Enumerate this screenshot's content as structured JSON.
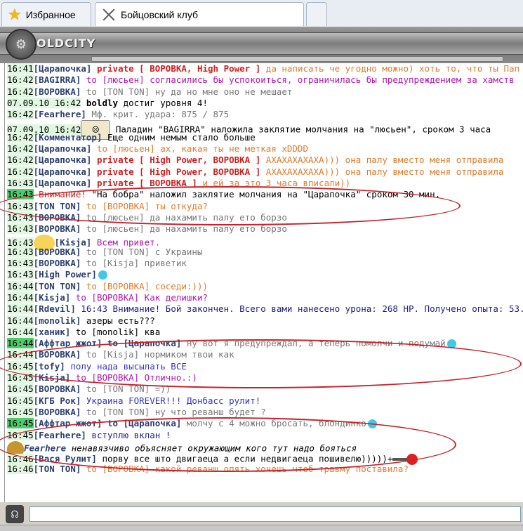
{
  "tabs": [
    {
      "label": "Избранное",
      "icon": "star-icon"
    },
    {
      "label": "Бойцовский клуб",
      "icon": "crossed-swords-icon"
    }
  ],
  "header": {
    "logo_text": "OLDCITY",
    "emblem": "⚙"
  },
  "chat": [
    {
      "ts": "16:41",
      "parts": [
        [
          "nick",
          "[Царапочка]"
        ],
        [
          "private",
          " private [ ВОРОВКА, High Power ]"
        ],
        [
          "m-orange",
          " да написать че угодно можно) хоть то, что ты Пап"
        ]
      ]
    },
    {
      "ts": "16:42",
      "parts": [
        [
          "nick",
          "[BAGIRRA]"
        ],
        [
          "m-magenta",
          " to [люсьен] согласились бы успокоиться, ограничилась бы предупреждением за хамств"
        ]
      ]
    },
    {
      "ts": "16:42",
      "parts": [
        [
          "nick",
          "[ВОРОВКА]"
        ],
        [
          "m-gray",
          " to [TON TON] ну да но мне оно не мешает"
        ]
      ]
    },
    {
      "ts": "07.09.10 16:42",
      "parts": [
        [
          "boldly",
          " boldly"
        ],
        [
          "m-black",
          " достиг уровня 4!"
        ]
      ]
    },
    {
      "ts": "16:42",
      "parts": [
        [
          "nick",
          "[Fearhere]"
        ],
        [
          "m-gray",
          " Мф. крит. удара: 875 / 875"
        ]
      ]
    },
    {
      "ts": "07.09.10 16:42",
      "emote": "scroll",
      "parts": [
        [
          "m-black",
          " Паладин \"BAGIRRA\" наложила заклятие молчания на \"люсьен\", сроком 3 часа"
        ]
      ]
    },
    {
      "ts": "16:42",
      "parts": [
        [
          "nick",
          "[Комментатор]"
        ],
        [
          "m-black",
          " Еще одним немым стало больше"
        ]
      ]
    },
    {
      "ts": "16:42",
      "parts": [
        [
          "nick",
          "[Царапочка]"
        ],
        [
          "m-orange",
          " to [люсьен] ах, какая ты не меткая xDDDD"
        ]
      ]
    },
    {
      "ts": "16:42",
      "parts": [
        [
          "nick",
          "[Царапочка]"
        ],
        [
          "private",
          " private [ High Power, ВОРОВКА ]"
        ],
        [
          "m-orange",
          " АХАХАХАХАХА))) она палу вместо меня отправила"
        ]
      ]
    },
    {
      "ts": "16:42",
      "parts": [
        [
          "nick",
          "[Царапочка]"
        ],
        [
          "private",
          " private [ High Power, ВОРОВКА ]"
        ],
        [
          "m-orange",
          " АХАХАХАХАХА))) она палу вместо меня отправила"
        ]
      ]
    },
    {
      "ts": "16:43",
      "parts": [
        [
          "nick",
          "[Царапочка]"
        ],
        [
          "private",
          " private [ ВОРОВКА ]"
        ],
        [
          "m-orange",
          " и ей за это 3 часа вписали))"
        ]
      ]
    },
    {
      "ts": "16:43",
      "hl": true,
      "parts": [
        [
          "att",
          " Внимание!"
        ],
        [
          "m-black",
          " \"На бобра\" наложил заклятие молчания на \"Царапочка\" сроком 30 мин."
        ]
      ]
    },
    {
      "ts": "16:43",
      "parts": [
        [
          "nick",
          "[TON TON]"
        ],
        [
          "m-orange",
          " to [ВОРОВКА] ты откуда?"
        ]
      ]
    },
    {
      "ts": "16:43",
      "parts": [
        [
          "nick",
          "[ВОРОВКА]"
        ],
        [
          "m-gray",
          " to [люсьен] да нахамить палу ето борзо"
        ]
      ]
    },
    {
      "ts": "16:43",
      "parts": [
        [
          "nick",
          "[ВОРОВКА]"
        ],
        [
          "m-gray",
          " to [люсьен] да нахамить палу ето борзо"
        ]
      ]
    },
    {
      "ts": "16:43",
      "emote": "kisja",
      "parts": [
        [
          "nick",
          "[Kisja]"
        ],
        [
          "m-magenta",
          " Всем привет."
        ]
      ]
    },
    {
      "ts": "16:43",
      "parts": [
        [
          "nick",
          "[ВОРОВКА]"
        ],
        [
          "m-gray",
          " to [TON TON] с Украины"
        ]
      ]
    },
    {
      "ts": "16:43",
      "parts": [
        [
          "nick",
          "[ВОРОВКА]"
        ],
        [
          "m-gray",
          " to [Kisja] приветик"
        ]
      ]
    },
    {
      "ts": "16:43",
      "smile": true,
      "parts": [
        [
          "nick",
          "[High Power]"
        ]
      ]
    },
    {
      "ts": "16:44",
      "parts": [
        [
          "nick",
          "[TON TON]"
        ],
        [
          "m-orange",
          " to [ВОРОВКА] соседи:)))"
        ]
      ]
    },
    {
      "ts": "16:44",
      "parts": [
        [
          "nick",
          "[Kisja]"
        ],
        [
          "m-magenta",
          " to [ВОРОВКА] Как делишки?"
        ]
      ]
    },
    {
      "ts": "16:44",
      "parts": [
        [
          "nick",
          "[Rdevil]"
        ],
        [
          "m-darkblue",
          " 16:43 Внимание! Бой закончен. Всего вами нанесено урона: 268 HP. Получено опыта: 53."
        ]
      ]
    },
    {
      "ts": "16:44",
      "parts": [
        [
          "nick",
          "[monolik]"
        ],
        [
          "m-black",
          " азеры есть???"
        ]
      ]
    },
    {
      "ts": "16:44",
      "parts": [
        [
          "nick",
          "[ханик]"
        ],
        [
          "m-black",
          " to [monolik] ква"
        ]
      ]
    },
    {
      "ts": "16:44",
      "hl": true,
      "smile": true,
      "parts": [
        [
          "nick",
          "[Аффтар жжот]"
        ],
        [
          "nick",
          " to [Царапочка]"
        ],
        [
          "m-gray",
          " ну вот я предупреждал, а теперь помолчи и подумай"
        ]
      ]
    },
    {
      "ts": "16:44",
      "parts": [
        [
          "nick",
          "[ВОРОВКА]"
        ],
        [
          "m-gray",
          " to [Kisja] нормиком твои как"
        ]
      ]
    },
    {
      "ts": "16:45",
      "parts": [
        [
          "nick",
          "[tofy]"
        ],
        [
          "m-blue",
          " полу нада высылать ВСЕ"
        ]
      ]
    },
    {
      "ts": "16:45",
      "parts": [
        [
          "nick",
          "[Kisja]"
        ],
        [
          "m-magenta",
          " to [ВОРОВКА] Отлично.:)"
        ]
      ]
    },
    {
      "ts": "16:45",
      "parts": [
        [
          "nick",
          "[ВОРОВКА]"
        ],
        [
          "m-gray",
          " to [TON TON] =))"
        ]
      ]
    },
    {
      "ts": "16:45",
      "parts": [
        [
          "nick",
          "[КГБ Рок]"
        ],
        [
          "m-blue",
          " Украина FOREVER!!! Донбасс рулит!"
        ]
      ]
    },
    {
      "ts": "16:45",
      "parts": [
        [
          "nick",
          "[ВОРОВКА]"
        ],
        [
          "m-gray",
          " to [TON TON] ну что реванш будет ?"
        ]
      ]
    },
    {
      "ts": "16:45",
      "hl": true,
      "smile": true,
      "parts": [
        [
          "nick",
          "[Аффтар жжот]"
        ],
        [
          "nick",
          " to [Царапочка]"
        ],
        [
          "m-gray",
          " молчу с 4 можно бросать, блондинко"
        ]
      ]
    },
    {
      "ts": "16:45",
      "parts": [
        [
          "nick",
          "[Fearhere]"
        ],
        [
          "m-darkblue",
          " вступлю вклан !"
        ]
      ]
    },
    {
      "ts": "",
      "emote": "hat",
      "parts": [
        [
          "nick-i",
          "Fearhere"
        ],
        [
          "m-black-i",
          " ненавязчиво объясняет окружающим кого тут надо бояться"
        ]
      ]
    },
    {
      "ts": "16:46",
      "emote": "gun",
      "parts": [
        [
          "nick",
          "[Вася Рулит]"
        ],
        [
          "m-black",
          " порву все што двигаеца а если недвигаеца пошивелю)))))+"
        ]
      ]
    },
    {
      "ts": "16:46",
      "parts": [
        [
          "nick",
          "[TON TON]"
        ],
        [
          "m-orange",
          " to [ВОРОВКА] какой реванш опять хочешь чтоб травму поставила?"
        ]
      ]
    }
  ],
  "input": {
    "value": ""
  }
}
